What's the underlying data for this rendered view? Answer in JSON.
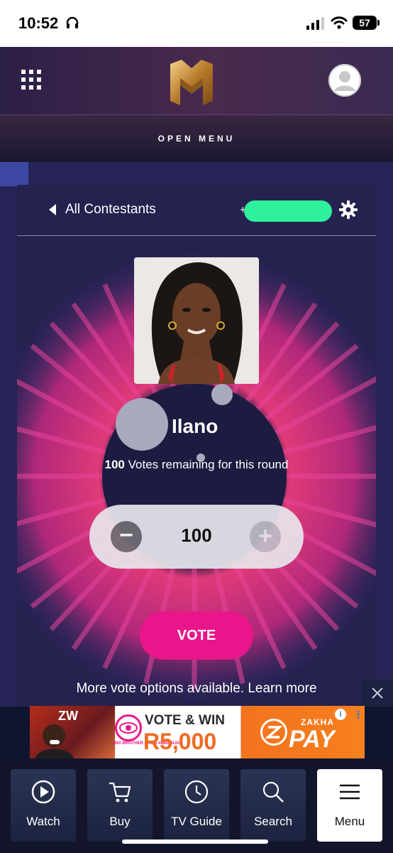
{
  "status_bar": {
    "time": "10:52",
    "battery": "57"
  },
  "header": {
    "open_menu_label": "OPEN MENU"
  },
  "contestant_page": {
    "back_label": "All Contestants",
    "phone_prefix": "+",
    "name": "Ilano",
    "votes_remaining_count": "100",
    "votes_remaining_text": " Votes remaining for this round",
    "stepper_minus": "−",
    "stepper_value": "100",
    "stepper_plus": "+",
    "vote_button": "VOTE",
    "more_options": "More vote options available. Learn more"
  },
  "ad": {
    "headline": "VOTE & WIN",
    "prize": "R5,000",
    "brand_small": "ZAKHA",
    "brand_large": "PAY",
    "info": "i",
    "more": "⋮",
    "badge_text": "BIG BROTHER NAIJA #BBNAIJA"
  },
  "bottom_nav": {
    "items": [
      {
        "label": "Watch",
        "icon": "play-circle-icon"
      },
      {
        "label": "Buy",
        "icon": "cart-icon"
      },
      {
        "label": "TV Guide",
        "icon": "clock-icon"
      },
      {
        "label": "Search",
        "icon": "search-icon"
      },
      {
        "label": "Menu",
        "icon": "hamburger-icon"
      }
    ]
  },
  "colors": {
    "accent_pink": "#e8168a",
    "highlight_green": "#2ff09a",
    "background_navy": "#24224f"
  }
}
